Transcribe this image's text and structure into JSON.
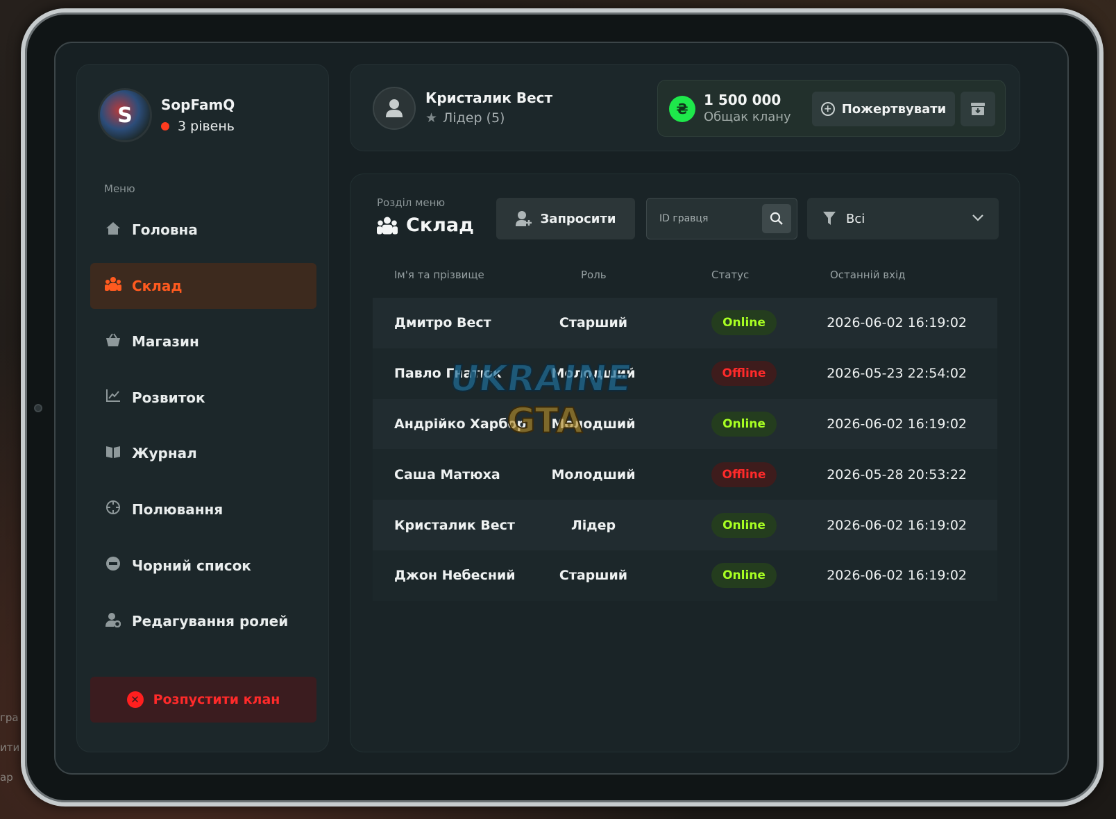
{
  "background_hints": [
    "гра",
    "ити",
    "ар"
  ],
  "clan": {
    "name": "SopFamQ",
    "level": "3 рівень",
    "avatar_letter": "S"
  },
  "sidebar": {
    "caption": "Меню",
    "items": [
      {
        "label": "Головна",
        "icon": "home-icon"
      },
      {
        "label": "Склад",
        "icon": "people-icon",
        "active": true
      },
      {
        "label": "Магазин",
        "icon": "basket-icon"
      },
      {
        "label": "Розвиток",
        "icon": "chart-icon"
      },
      {
        "label": "Журнал",
        "icon": "book-icon"
      },
      {
        "label": "Полювання",
        "icon": "crosshair-icon"
      },
      {
        "label": "Чорний список",
        "icon": "block-icon"
      },
      {
        "label": "Редагування ролей",
        "icon": "user-gear-icon"
      }
    ],
    "disband_label": "Розпустити клан"
  },
  "header": {
    "user_name": "Кристалик Вест",
    "user_role": "Лідер (5)",
    "bank_amount": "1 500 000",
    "bank_label": "Общак клану",
    "currency_symbol": "₴",
    "donate_label": "Пожертвувати"
  },
  "main": {
    "section_caption": "Розділ меню",
    "section_title": "Склад",
    "invite_label": "Запросити",
    "search_placeholder": "ID гравця",
    "filter_value": "Всі",
    "columns": [
      "Ім'я та прізвище",
      "Роль",
      "Статус",
      "Останній вхід"
    ],
    "rows": [
      {
        "name": "Дмитро Вест",
        "role": "Старший",
        "status": "Online",
        "last": "2026-06-02 16:19:02"
      },
      {
        "name": "Павло Гнатюк",
        "role": "Молодший",
        "status": "Offline",
        "last": "2026-05-23 22:54:02"
      },
      {
        "name": "Андрійко Харбор",
        "role": "Молодший",
        "status": "Online",
        "last": "2026-06-02 16:19:02"
      },
      {
        "name": "Саша Матюха",
        "role": "Молодший",
        "status": "Offline",
        "last": "2026-05-28 20:53:22"
      },
      {
        "name": "Кристалик Вест",
        "role": "Лідер",
        "status": "Online",
        "last": "2026-06-02 16:19:02"
      },
      {
        "name": "Джон Небесний",
        "role": "Старший",
        "status": "Online",
        "last": "2026-06-02 16:19:02"
      }
    ]
  },
  "watermark": {
    "line1": "UKRAINE",
    "line2": "GTA"
  },
  "colors": {
    "accent": "#ff5a1f",
    "online": "#a8ff22",
    "offline": "#ff2a2a",
    "bank_coin": "#1ee84b"
  }
}
